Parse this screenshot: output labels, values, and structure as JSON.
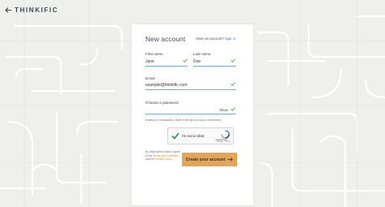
{
  "header": {
    "brand": "THINKIFIC",
    "back_icon": "arrow-left-icon"
  },
  "form": {
    "title": "New account",
    "have_account_text": "Have an account?",
    "sign_in_link": "Sign in",
    "first_name": {
      "label": "First name",
      "value": "Jane"
    },
    "last_name": {
      "label": "Last name",
      "value": "Doe"
    },
    "email": {
      "label": "Email",
      "value": "example@thinkific.com"
    },
    "password": {
      "label": "Choose a password",
      "show_label": "Show",
      "hint": "Minimum 8 characters. Make it strong but easy to remember."
    },
    "captcha": {
      "label": "I'm not a robot",
      "brand": "reCAPTCHA",
      "links": "Privacy - Terms",
      "checked": true
    },
    "terms": {
      "prefix": "By clicking this button I agree to the",
      "terms_link": "Terms and Conditions",
      "and": "and the",
      "privacy_link": "Privacy Policy"
    },
    "submit_label": "Create your account"
  },
  "colors": {
    "accent": "#e3a55a",
    "link": "#2f7fbf",
    "check": "#5aa84a",
    "field_underline": "#7aa7d1"
  }
}
